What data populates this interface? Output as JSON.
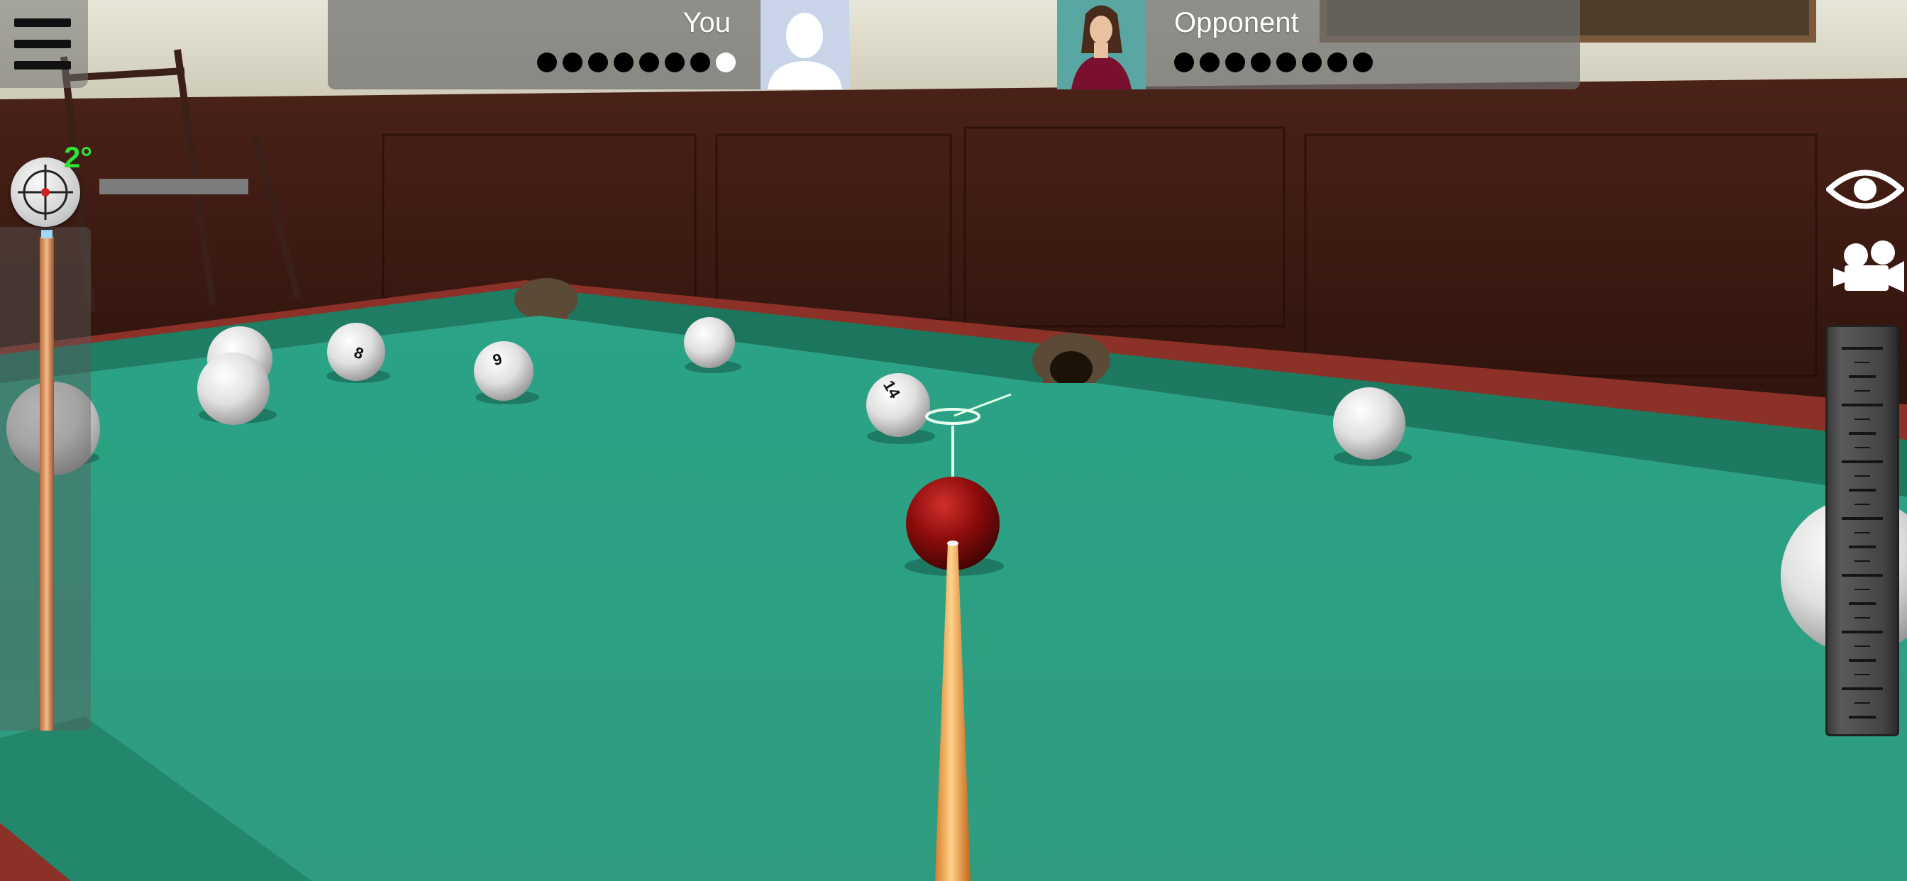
{
  "players": {
    "you": {
      "name": "You",
      "balls": [
        "black",
        "black",
        "black",
        "black",
        "black",
        "black",
        "black",
        "white"
      ]
    },
    "opponent": {
      "name": "Opponent",
      "balls": [
        "black",
        "black",
        "black",
        "black",
        "black",
        "black",
        "black",
        "black"
      ]
    }
  },
  "aim": {
    "angle_label": "2°"
  },
  "balls": [
    {
      "number": "8"
    },
    {
      "number": "9"
    },
    {
      "number": "14"
    }
  ],
  "colors": {
    "felt": "#2a9f82",
    "rail": "#1e7d64",
    "wood": "#3b1a12",
    "cue_ball": "#8a0c0c",
    "angle_text": "#33e233"
  },
  "icons": {
    "menu": "hamburger-icon",
    "spin": "crosshair-icon",
    "view": "eye-icon",
    "camera": "movie-camera-icon"
  }
}
